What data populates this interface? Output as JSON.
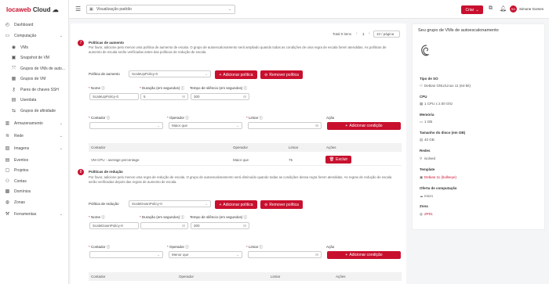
{
  "brand": {
    "name": "locaweb",
    "cloud": "Cloud"
  },
  "sidebar": {
    "items": [
      {
        "label": "Dashboard",
        "icon": "dashboard-icon",
        "expandable": false
      },
      {
        "label": "Computação",
        "icon": "computer-icon",
        "expandable": true
      },
      {
        "label": "VMs",
        "icon": "eye-icon",
        "sub": true
      },
      {
        "label": "Snapshot de VM",
        "icon": "snapshot-icon",
        "sub": true
      },
      {
        "label": "Grupos de VMs de auto...",
        "icon": "autoscale-icon",
        "sub": true
      },
      {
        "label": "Grupos de VM",
        "icon": "group-icon",
        "sub": true
      },
      {
        "label": "Pares de chaves SSH",
        "icon": "key-icon",
        "sub": true
      },
      {
        "label": "Userdata",
        "icon": "file-icon",
        "sub": true
      },
      {
        "label": "Grupos de afinidade",
        "icon": "affinity-icon",
        "sub": true
      },
      {
        "label": "Armazenamento",
        "icon": "storage-icon",
        "expandable": true
      },
      {
        "label": "Rede",
        "icon": "wifi-icon",
        "expandable": true
      },
      {
        "label": "Imagens",
        "icon": "image-icon",
        "expandable": true
      },
      {
        "label": "Eventos",
        "icon": "events-icon",
        "expandable": false
      },
      {
        "label": "Projetos",
        "icon": "projects-icon",
        "expandable": false
      },
      {
        "label": "Contas",
        "icon": "accounts-icon",
        "expandable": false
      },
      {
        "label": "Domínios",
        "icon": "domains-icon",
        "expandable": false
      },
      {
        "label": "Zonas",
        "icon": "globe-icon",
        "expandable": false
      },
      {
        "label": "Ferramentas",
        "icon": "tools-icon",
        "expandable": true
      }
    ]
  },
  "topbar": {
    "view_select": "Visualização padrão",
    "create_label": "Criar",
    "user_name": "Simone Gomes",
    "user_initials": "SG"
  },
  "pagination": {
    "total": "Total 0 itens",
    "page": "1",
    "per_page": "10 / página"
  },
  "scale_up": {
    "number": "7",
    "title": "Políticas de aumento",
    "description": "Por favor, adicione pelo menos uma política de aumento de escala. O grupo de autoescalonamento será ampliado quando todas as condições de uma regra de escala forem atendidas. As políticas de aumento de escala serão verificadas antes das políticas de redução de escala.",
    "policy_label": "Política de aumento",
    "policy_value": "ScaleUpPolicy-0",
    "add_policy": "Adicionar política",
    "remove_policy": "Remover política",
    "name_label": "Nome",
    "name_value": "ScaleUpPolicy-0",
    "duration_label": "Duração (em segundos)",
    "duration_value": "5",
    "silence_label": "Tempo de silêncio (em segundos)",
    "silence_value": "300",
    "counter_label": "Contador",
    "operator_label": "Operador",
    "operator_value": "Maior que",
    "threshold_label": "Limiar",
    "action_label": "Ação",
    "add_condition": "Adicionar condição",
    "table_headers": [
      "Contador",
      "Operador",
      "Limiar",
      "Ações"
    ],
    "rows": [
      {
        "counter": "VM CPU - average percentage",
        "operator": "Maior que",
        "threshold": "75",
        "action": "Excluir"
      }
    ]
  },
  "scale_down": {
    "number": "8",
    "title": "Políticas de redução",
    "description": "Por favor, adicione pelo menos uma regra de redução de escala. O grupo de autoescalonamento será diminuído quando todas as condições dessa regra forem atendidas. As regras de redução de escala serão verificadas depois das regras de aumento de escala.",
    "policy_label": "Política de redução",
    "policy_value": "ScaleDownPolicy-0",
    "add_policy": "Adicionar política",
    "remove_policy": "Remover política",
    "name_label": "Nome",
    "name_value": "ScaleDownPolicy-0",
    "duration_label": "Duração (em segundos)",
    "silence_label": "Tempo de silêncio (em segundos)",
    "silence_value": "300",
    "counter_label": "Contador",
    "operator_label": "Operador",
    "operator_value": "Menor que",
    "threshold_label": "Limiar",
    "action_label": "Ação",
    "add_condition": "Adicionar condição",
    "table_headers": [
      "Contador",
      "Operador",
      "Limiar",
      "Ações"
    ]
  },
  "summary": {
    "title": "Seu grupo de VMs de autoescalonamento",
    "os_type_label": "Tipo de SO",
    "os_type_value": "Debian GNU/Linux 11 (64-bit)",
    "cpu_label": "CPU",
    "cpu_value": "1 CPU x 2.00 Ghz",
    "memory_label": "Memória",
    "memory_value": "1 GB",
    "disk_label": "Tamanho do disco (em GB)",
    "disk_value": "40 GB",
    "networks_label": "Redes",
    "networks_value": "isolved",
    "template_label": "Template",
    "template_value": "Debian 11 (bullseye)",
    "offering_label": "Oferta de computação",
    "offering_value": "micro",
    "zone_label": "Zona",
    "zone_value": "ZP01"
  },
  "colors": {
    "accent": "#c8102e"
  }
}
